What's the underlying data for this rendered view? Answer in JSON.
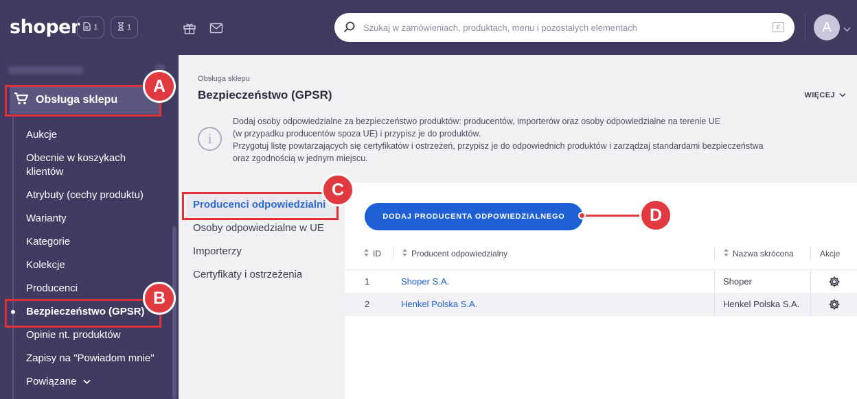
{
  "app": {
    "logo": "shoper"
  },
  "top_bar": {
    "orders_count": "1",
    "tasks_count": "1",
    "search_placeholder": "Szukaj w zamówieniach, produktach, menu i pozostałych elementach",
    "search_shortcut": "F",
    "avatar_letter": "A"
  },
  "sidebar": {
    "section_title": "Obsługa sklepu",
    "items": [
      {
        "label": "Aukcje"
      },
      {
        "label": "Obecnie w koszykach"
      },
      {
        "label": "klientów"
      },
      {
        "label": "Atrybuty (cechy produktu)"
      },
      {
        "label": "Warianty"
      },
      {
        "label": "Kategorie"
      },
      {
        "label": "Kolekcje"
      },
      {
        "label": "Producenci"
      },
      {
        "label": "Bezpieczeństwo (GPSR)"
      },
      {
        "label": "Opinie nt. produktów"
      },
      {
        "label": "Zapisy na \"Powiadom mnie\""
      },
      {
        "label": "Powiązane"
      }
    ],
    "active_item": "Bezpieczeństwo (GPSR)"
  },
  "main": {
    "breadcrumb": "Obsługa sklepu",
    "title": "Bezpieczeństwo (GPSR)",
    "more_label": "WIĘCEJ",
    "info_lines": [
      "Dodaj osoby odpowiedzialne za bezpieczeństwo produktów: producentów, importerów oraz osoby odpowiedzialne na terenie UE",
      "(w przypadku producentów spoza UE) i przypisz je do produktów.",
      "Przygotuj listę powtarzających się certyfikatów i ostrzeżeń, przypisz je do odpowiednich produktów i zarządzaj standardami bezpieczeństwa",
      "oraz zgodnością w jednym miejscu."
    ],
    "tabs": [
      {
        "label": "Producenci odpowiedzialni"
      },
      {
        "label": "Osoby odpowiedzialne w UE"
      },
      {
        "label": "Importerzy"
      },
      {
        "label": "Certyfikaty i ostrzeżenia"
      }
    ],
    "active_tab": "Producenci odpowiedzialni",
    "add_button": "DODAJ PRODUCENTA ODPOWIEDZIALNEGO",
    "table": {
      "columns": [
        "ID",
        "Producent odpowiedzialny",
        "Nazwa skrócona",
        "Akcje"
      ],
      "rows": [
        {
          "id": "1",
          "producer": "Shoper S.A.",
          "short_name": "Shoper"
        },
        {
          "id": "2",
          "producer": "Henkel Polska S.A.",
          "short_name": "Henkel Polska S.A."
        }
      ]
    }
  },
  "annotations": {
    "a": "A",
    "b": "B",
    "c": "C",
    "d": "D"
  },
  "colors": {
    "sidebar_bg": "#403b60",
    "accent_blue": "#1e5fd3",
    "annotation_red": "#e0303a"
  },
  "icons": [
    "cart-icon",
    "document-icon",
    "hourglass-icon",
    "gift-icon",
    "mail-icon",
    "search-icon",
    "chevron-down-icon",
    "info-icon",
    "sort-icon",
    "gear-icon"
  ]
}
